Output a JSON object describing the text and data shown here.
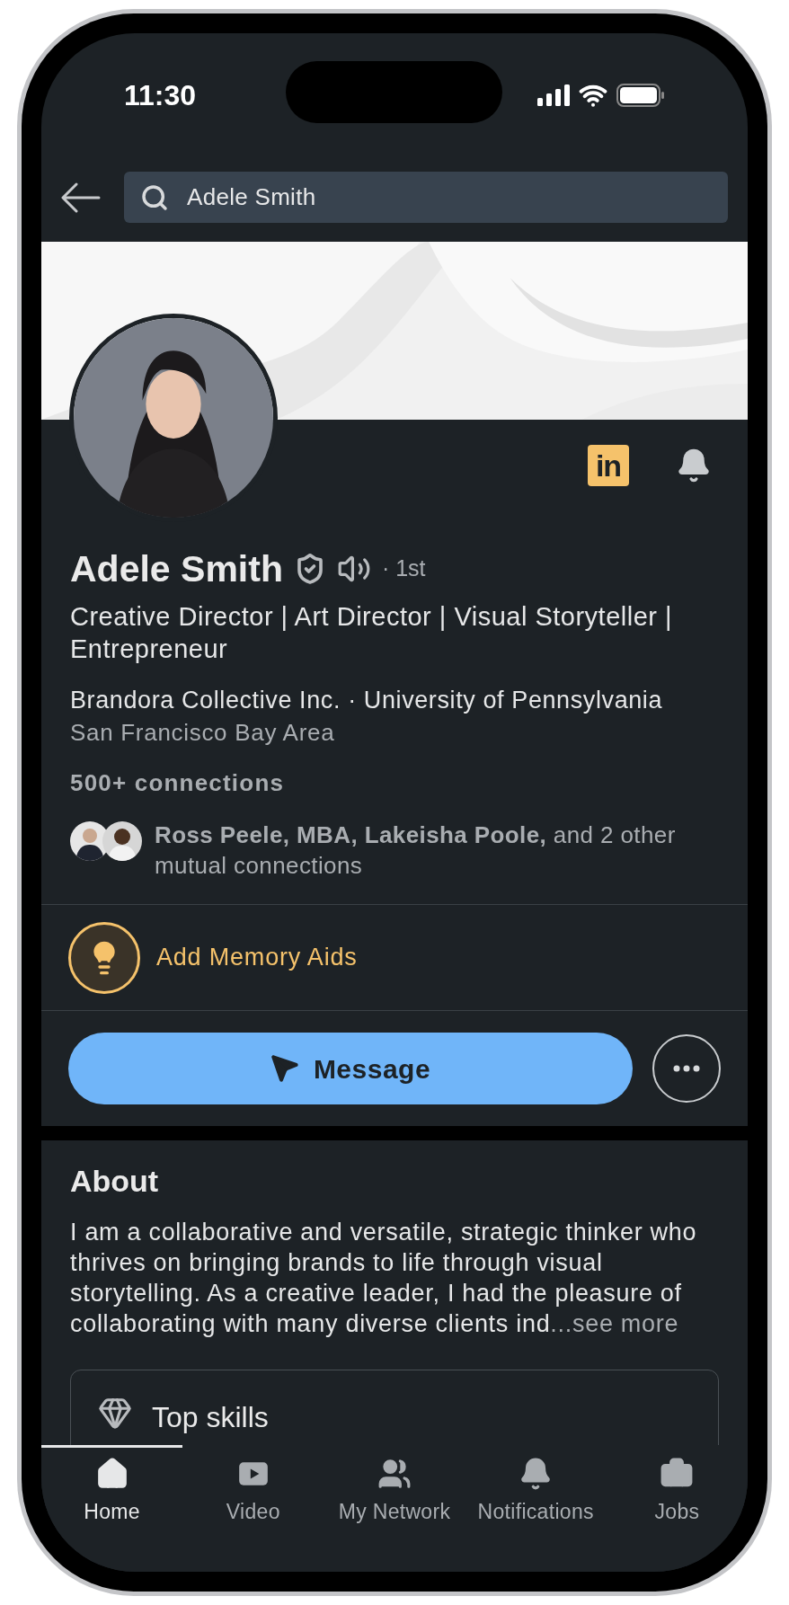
{
  "status_bar": {
    "time": "11:30"
  },
  "search": {
    "value": "Adele Smith"
  },
  "profile": {
    "logo_text": "in",
    "name": "Adele Smith",
    "degree": "· 1st",
    "headline": "Creative Director | Art Director | Visual Storyteller | Entrepreneur",
    "affiliation": "Brandora Collective Inc. · University of Pennsylvania",
    "location": "San Francisco Bay Area",
    "connections": "500+ connections",
    "mutual": "**Ross Peele, MBA, Lakeisha Poole,** and 2 other mutual connections"
  },
  "memory_aids": {
    "label": "Add Memory Aids"
  },
  "actions": {
    "primary": "Message"
  },
  "about": {
    "title": "About",
    "text": "I am a collaborative and versatile, strategic thinker who thrives on bringing brands to life through visual storytelling. As a creative leader, I had the pleasure of collaborating with many diverse clients ind",
    "more": "...see more"
  },
  "top_skills": {
    "title": "Top skills"
  },
  "nav": [
    {
      "kind": "home",
      "label": "Home",
      "selected": true
    },
    {
      "kind": "video",
      "label": "Video",
      "selected": false
    },
    {
      "kind": "network",
      "label": "My Network",
      "selected": false
    },
    {
      "kind": "notifications",
      "label": "Notifications",
      "selected": false
    },
    {
      "kind": "jobs",
      "label": "Jobs",
      "selected": false
    }
  ]
}
